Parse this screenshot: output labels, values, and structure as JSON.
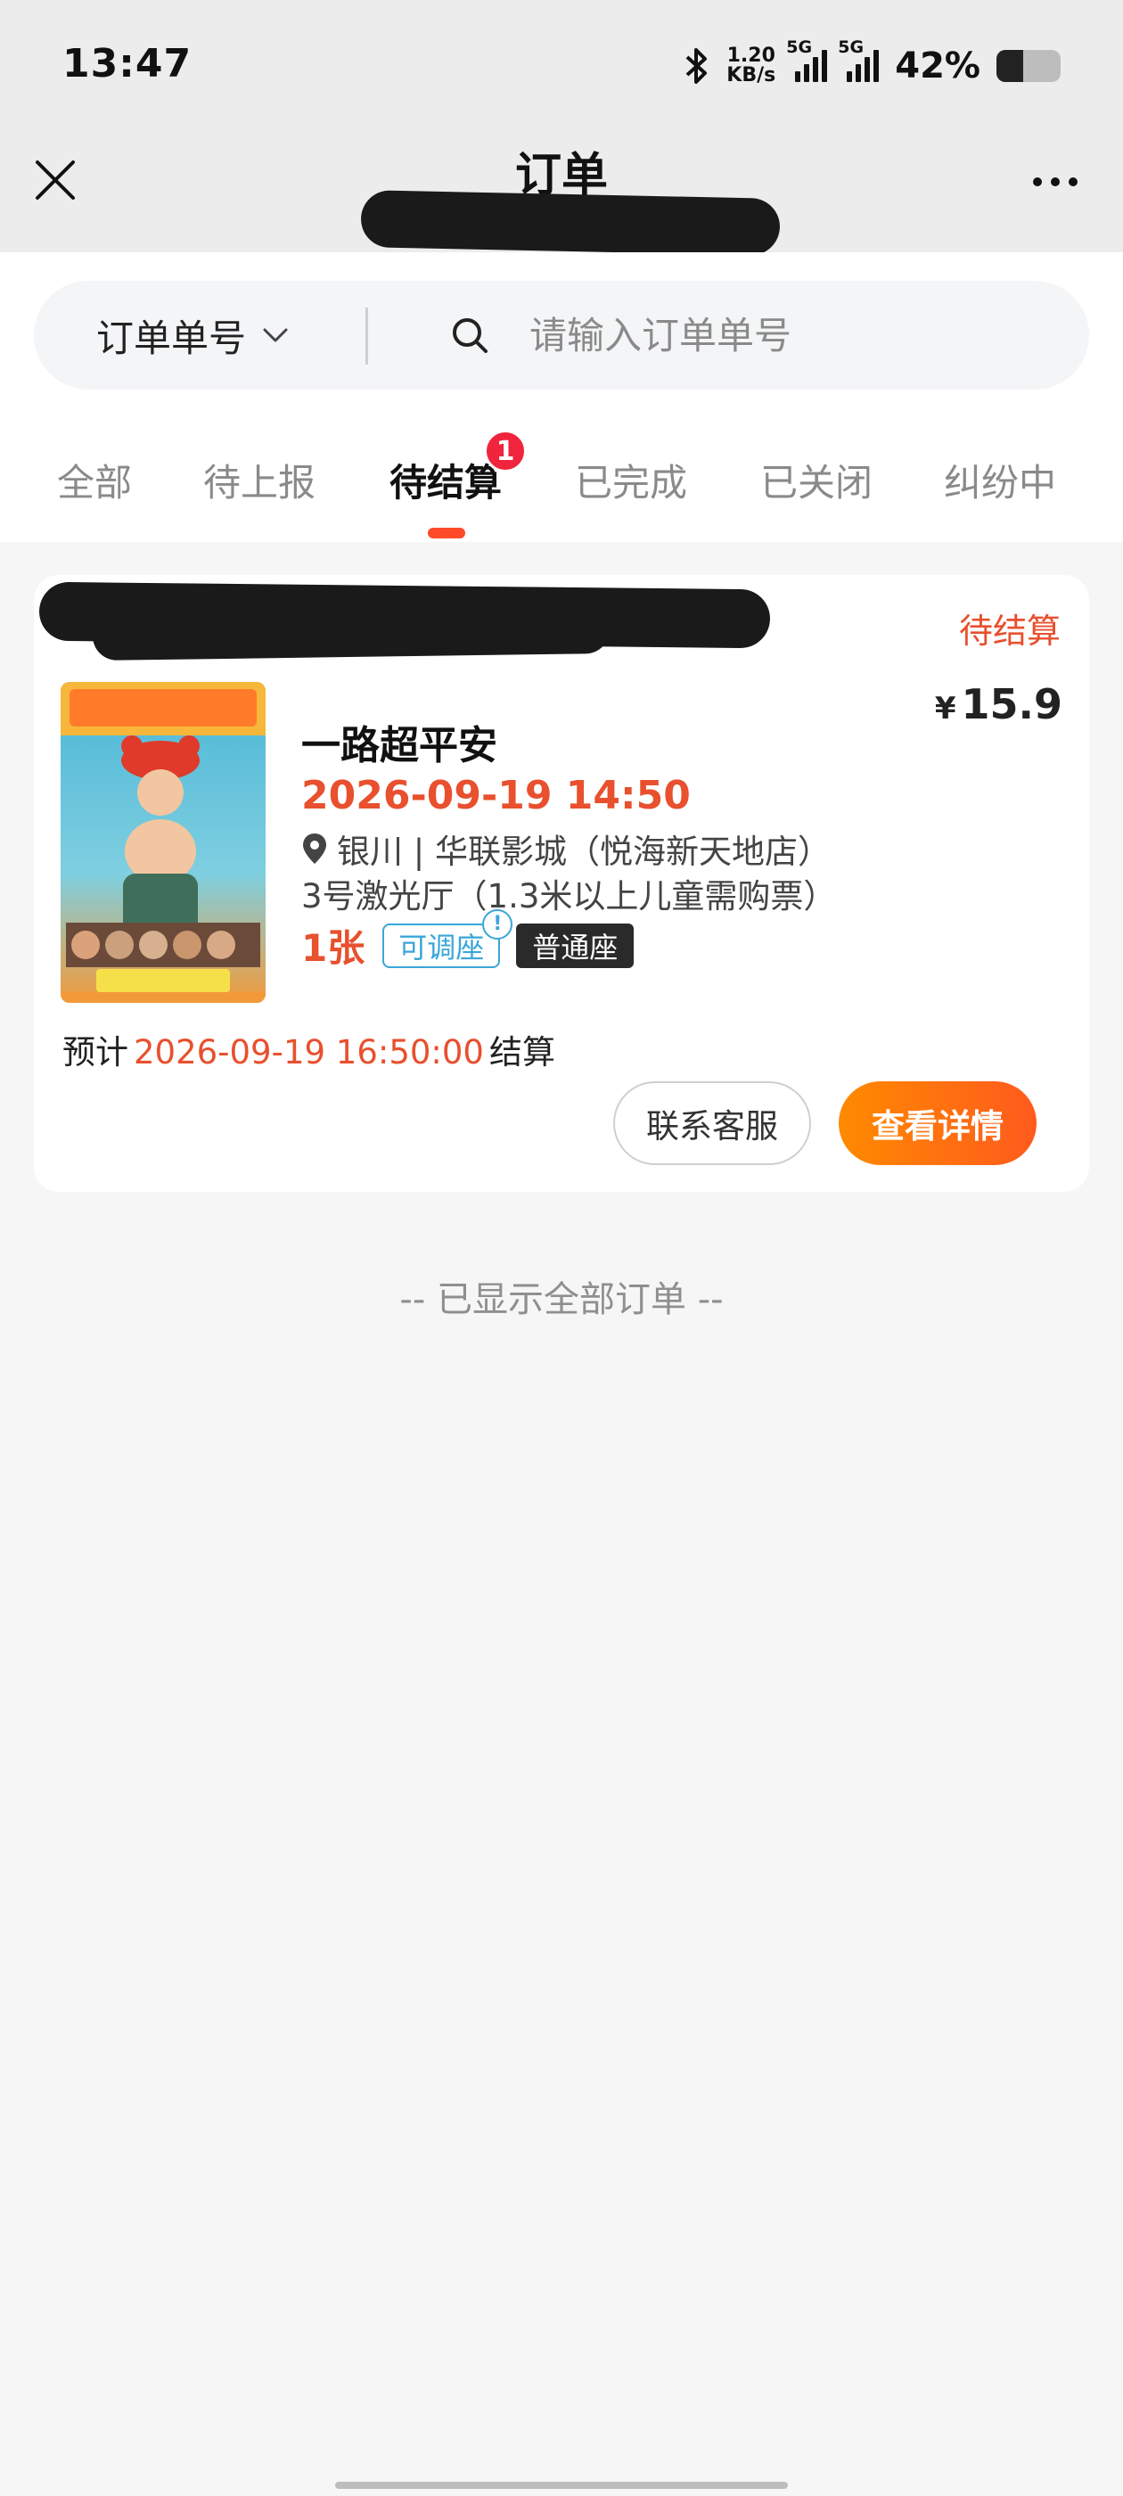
{
  "status_bar": {
    "time": "13:47",
    "net_speed_value": "1.20",
    "net_speed_unit": "KB/s",
    "sim1_type": "5G",
    "sim2_type": "5G",
    "battery_pct": "42%",
    "battery_level": 0.42
  },
  "header": {
    "title": "订单"
  },
  "search": {
    "type_label": "订单单号",
    "placeholder": "请输入订单单号",
    "value": ""
  },
  "tabs": [
    {
      "label": "全部"
    },
    {
      "label": "待上报"
    },
    {
      "label": "待结算",
      "badge": "1"
    },
    {
      "label": "已完成"
    },
    {
      "label": "已关闭"
    },
    {
      "label": "纠纷中"
    }
  ],
  "active_tab": "待结算",
  "order": {
    "status": "待结算",
    "price_symbol": "¥",
    "price": "15.9",
    "movie_title": "一路超平安",
    "show_time": "2026-09-19 14:50",
    "cinema": "银川 | 华联影城（悦海新天地店）",
    "hall": "3号激光厅（1.3米以上儿童需购票）",
    "ticket_count": "1张",
    "seat_adjust_label": "可调座",
    "info_mark": "!",
    "seat_type": "普通座",
    "settle_prefix": "预计",
    "settle_time": "2026-09-19 16:50:00",
    "settle_suffix": "结算",
    "contact_button": "联系客服",
    "detail_button": "查看详情"
  },
  "end_note": "-- 已显示全部订单 --",
  "colors": {
    "accent": "#e8502e",
    "badge": "#f0243c",
    "seat_adjust": "#3aa6d8",
    "detail_gradient_start": "#ff8a00",
    "detail_gradient_end": "#ff5a1e"
  }
}
